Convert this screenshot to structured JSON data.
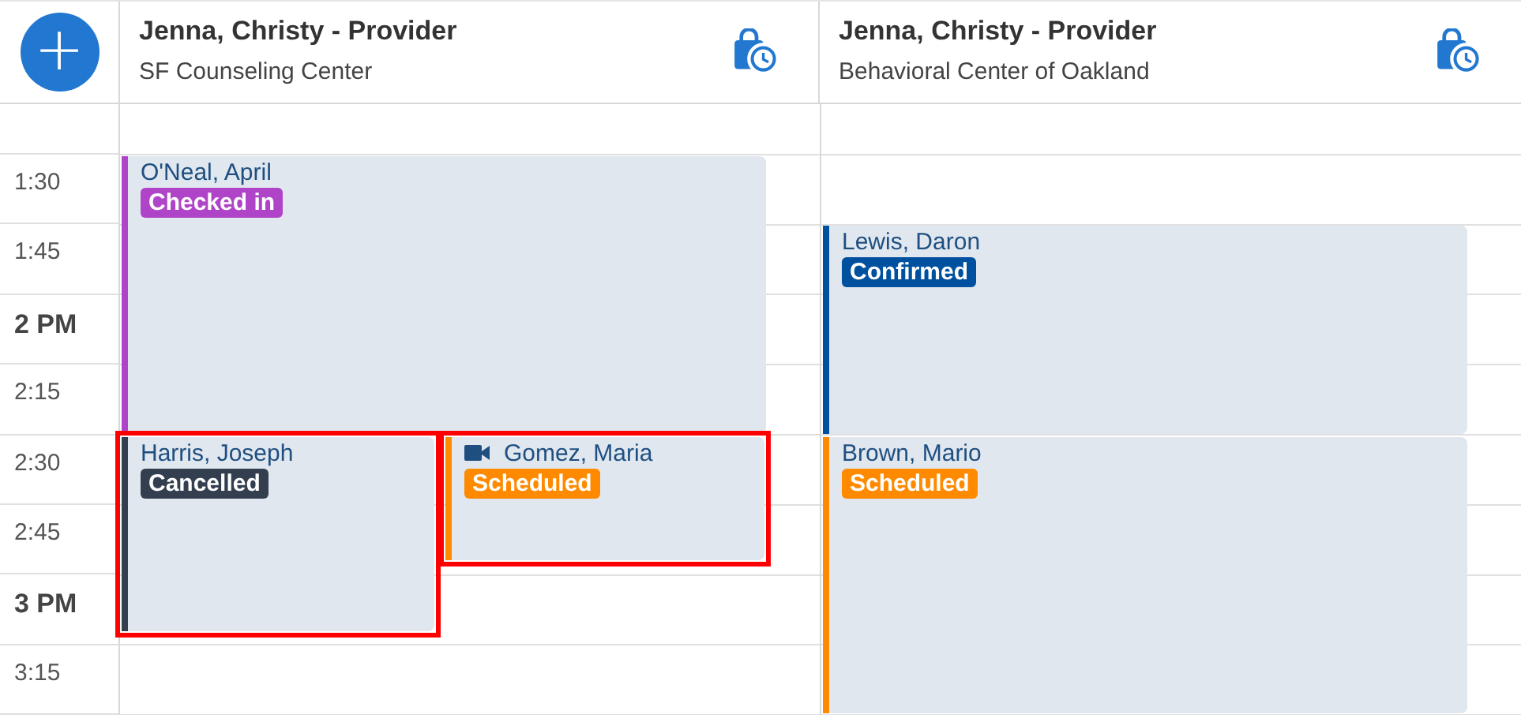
{
  "add_button": {
    "label": "+"
  },
  "time_slots": [
    {
      "label": "1:30",
      "kind": "quarter"
    },
    {
      "label": "1:45",
      "kind": "quarter"
    },
    {
      "label": "2 PM",
      "kind": "hour"
    },
    {
      "label": "2:15",
      "kind": "quarter"
    },
    {
      "label": "2:30",
      "kind": "quarter"
    },
    {
      "label": "2:45",
      "kind": "quarter"
    },
    {
      "label": "3 PM",
      "kind": "hour"
    },
    {
      "label": "3:15",
      "kind": "quarter"
    }
  ],
  "columns": [
    {
      "title": "Jenna, Christy - Provider",
      "location": "SF Counseling Center",
      "appointments": [
        {
          "name": "O'Neal, April",
          "video": false,
          "highlighted": false,
          "status": {
            "label": "Checked in",
            "color": "#b044c8"
          }
        },
        {
          "name": "Harris, Joseph",
          "video": false,
          "highlighted": true,
          "status": {
            "label": "Cancelled",
            "color": "#333f4f"
          }
        },
        {
          "name": "Gomez, Maria",
          "video": true,
          "highlighted": true,
          "status": {
            "label": "Scheduled",
            "color": "#ff8a00"
          }
        }
      ]
    },
    {
      "title": "Jenna, Christy - Provider",
      "location": "Behavioral Center of Oakland",
      "appointments": [
        {
          "name": "Lewis, Daron",
          "video": false,
          "highlighted": false,
          "status": {
            "label": "Confirmed",
            "color": "#0050a0"
          }
        },
        {
          "name": "Brown, Mario",
          "video": false,
          "highlighted": false,
          "status": {
            "label": "Scheduled",
            "color": "#ff8a00"
          }
        }
      ]
    }
  ]
}
